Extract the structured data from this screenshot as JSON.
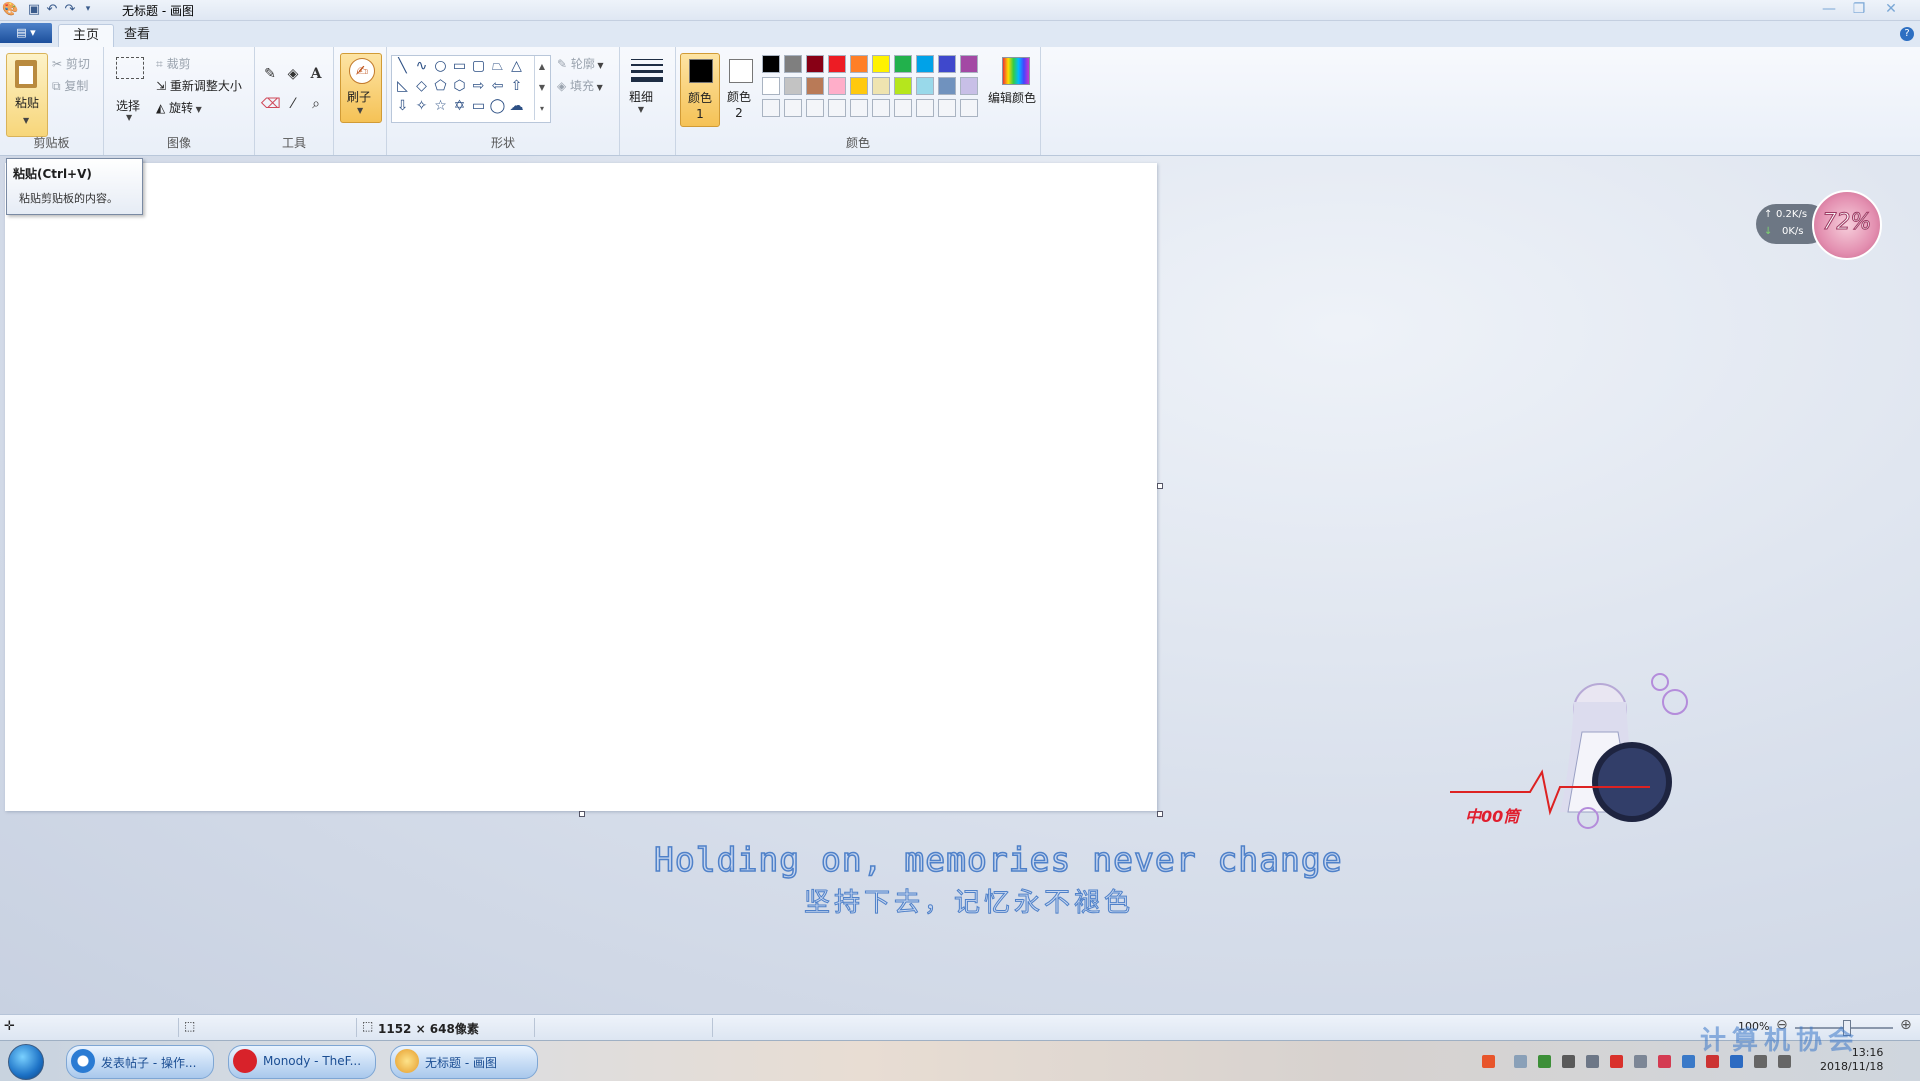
{
  "window": {
    "title": "无标题 - 画图",
    "tabs": [
      {
        "label": "主页"
      },
      {
        "label": "查看"
      }
    ]
  },
  "ribbon": {
    "clipboard": {
      "label": "剪贴板",
      "paste": "粘贴",
      "cut": "剪切",
      "copy": "复制"
    },
    "image": {
      "label": "图像",
      "select": "选择",
      "crop": "裁剪",
      "resize": "重新调整大小",
      "rotate": "旋转"
    },
    "tools": {
      "label": "工具"
    },
    "brushes": {
      "label": "刷子"
    },
    "shapes": {
      "label": "形状",
      "outline": "轮廓",
      "fill": "填充"
    },
    "size": {
      "label": "粗细"
    },
    "colors": {
      "label": "颜色",
      "color1": "颜色 1",
      "color2": "颜色 2",
      "edit": "编辑颜色",
      "palette_row1": [
        "#000000",
        "#7f7f7f",
        "#880015",
        "#ed1c24",
        "#ff7f27",
        "#fff200",
        "#22b14c",
        "#00a2e8",
        "#3f48cc",
        "#a349a4"
      ],
      "palette_row2": [
        "#ffffff",
        "#c3c3c3",
        "#b97a57",
        "#ffaec9",
        "#ffc90e",
        "#efe4b0",
        "#b5e61d",
        "#99d9ea",
        "#7092be",
        "#c8bfe7"
      ],
      "accent_active": "#f5c256"
    }
  },
  "tooltip": {
    "title": "粘贴(Ctrl+V)",
    "body": "粘贴剪贴板的内容。"
  },
  "statusbar": {
    "dimensions": "1152 × 648像素",
    "zoom": "100%"
  },
  "wallpaper": {
    "lyric_en": "Holding on, memories never change",
    "lyric_cn": "坚持下去，记忆永不褪色",
    "badge_text": "中00筒",
    "net_up": "0.2K/s",
    "net_down": "0K/s",
    "net_percent": "72%"
  },
  "taskbar": {
    "items": [
      {
        "label": "发表帖子 - 操作..."
      },
      {
        "label": "Monody - TheF..."
      },
      {
        "label": "无标题 - 画图"
      }
    ],
    "time": "13:16",
    "date": "2018/11/18",
    "watermark": "计算机协会"
  }
}
